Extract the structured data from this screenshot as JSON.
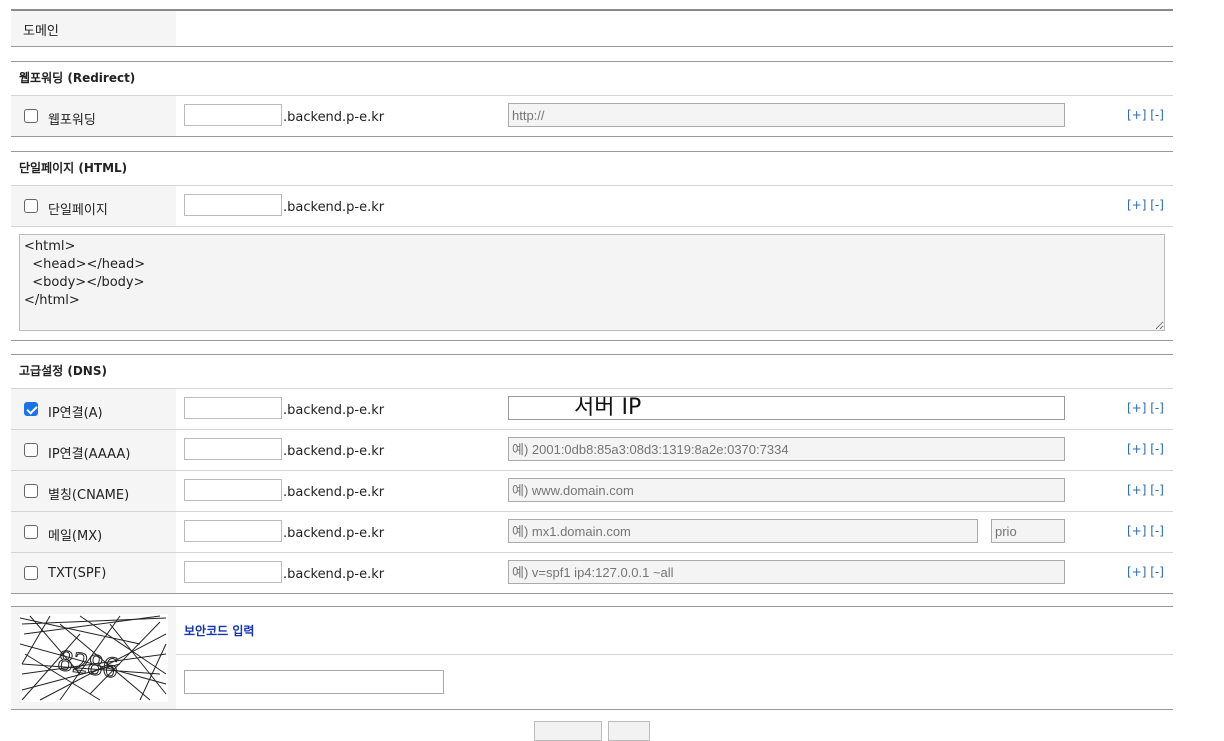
{
  "domain": {
    "label": "도메인"
  },
  "sections": {
    "redirect": "웹포워딩 (Redirect)",
    "html": "단일페이지 (HTML)",
    "dns": "고급설정 (DNS)"
  },
  "suffix": ".backend.p-e.kr",
  "controls": {
    "plus": "[+]",
    "minus": "[-]"
  },
  "redirect_row": {
    "label": "웹포워딩",
    "checked": false,
    "value_placeholder": "http://"
  },
  "html_row": {
    "label": "단일페이지",
    "checked": false,
    "code": "<html>\n  <head></head>\n  <body></body>\n</html>"
  },
  "dns_rows": [
    {
      "label": "IP연결(A)",
      "checked": true,
      "value": "서버 IP",
      "placeholder": ""
    },
    {
      "label": "IP연결(AAAA)",
      "checked": false,
      "value": "",
      "placeholder": "예) 2001:0db8:85a3:08d3:1319:8a2e:0370:7334"
    },
    {
      "label": "별칭(CNAME)",
      "checked": false,
      "value": "",
      "placeholder": "예) www.domain.com"
    },
    {
      "label": "메일(MX)",
      "checked": false,
      "value": "",
      "placeholder": "예) mx1.domain.com",
      "prio_placeholder": "prio"
    },
    {
      "label": "TXT(SPF)",
      "checked": false,
      "value": "",
      "placeholder": "예) v=spf1 ip4:127.0.0.1 ~all"
    }
  ],
  "captcha": {
    "label": "보안코드 입력",
    "code": "8286"
  }
}
